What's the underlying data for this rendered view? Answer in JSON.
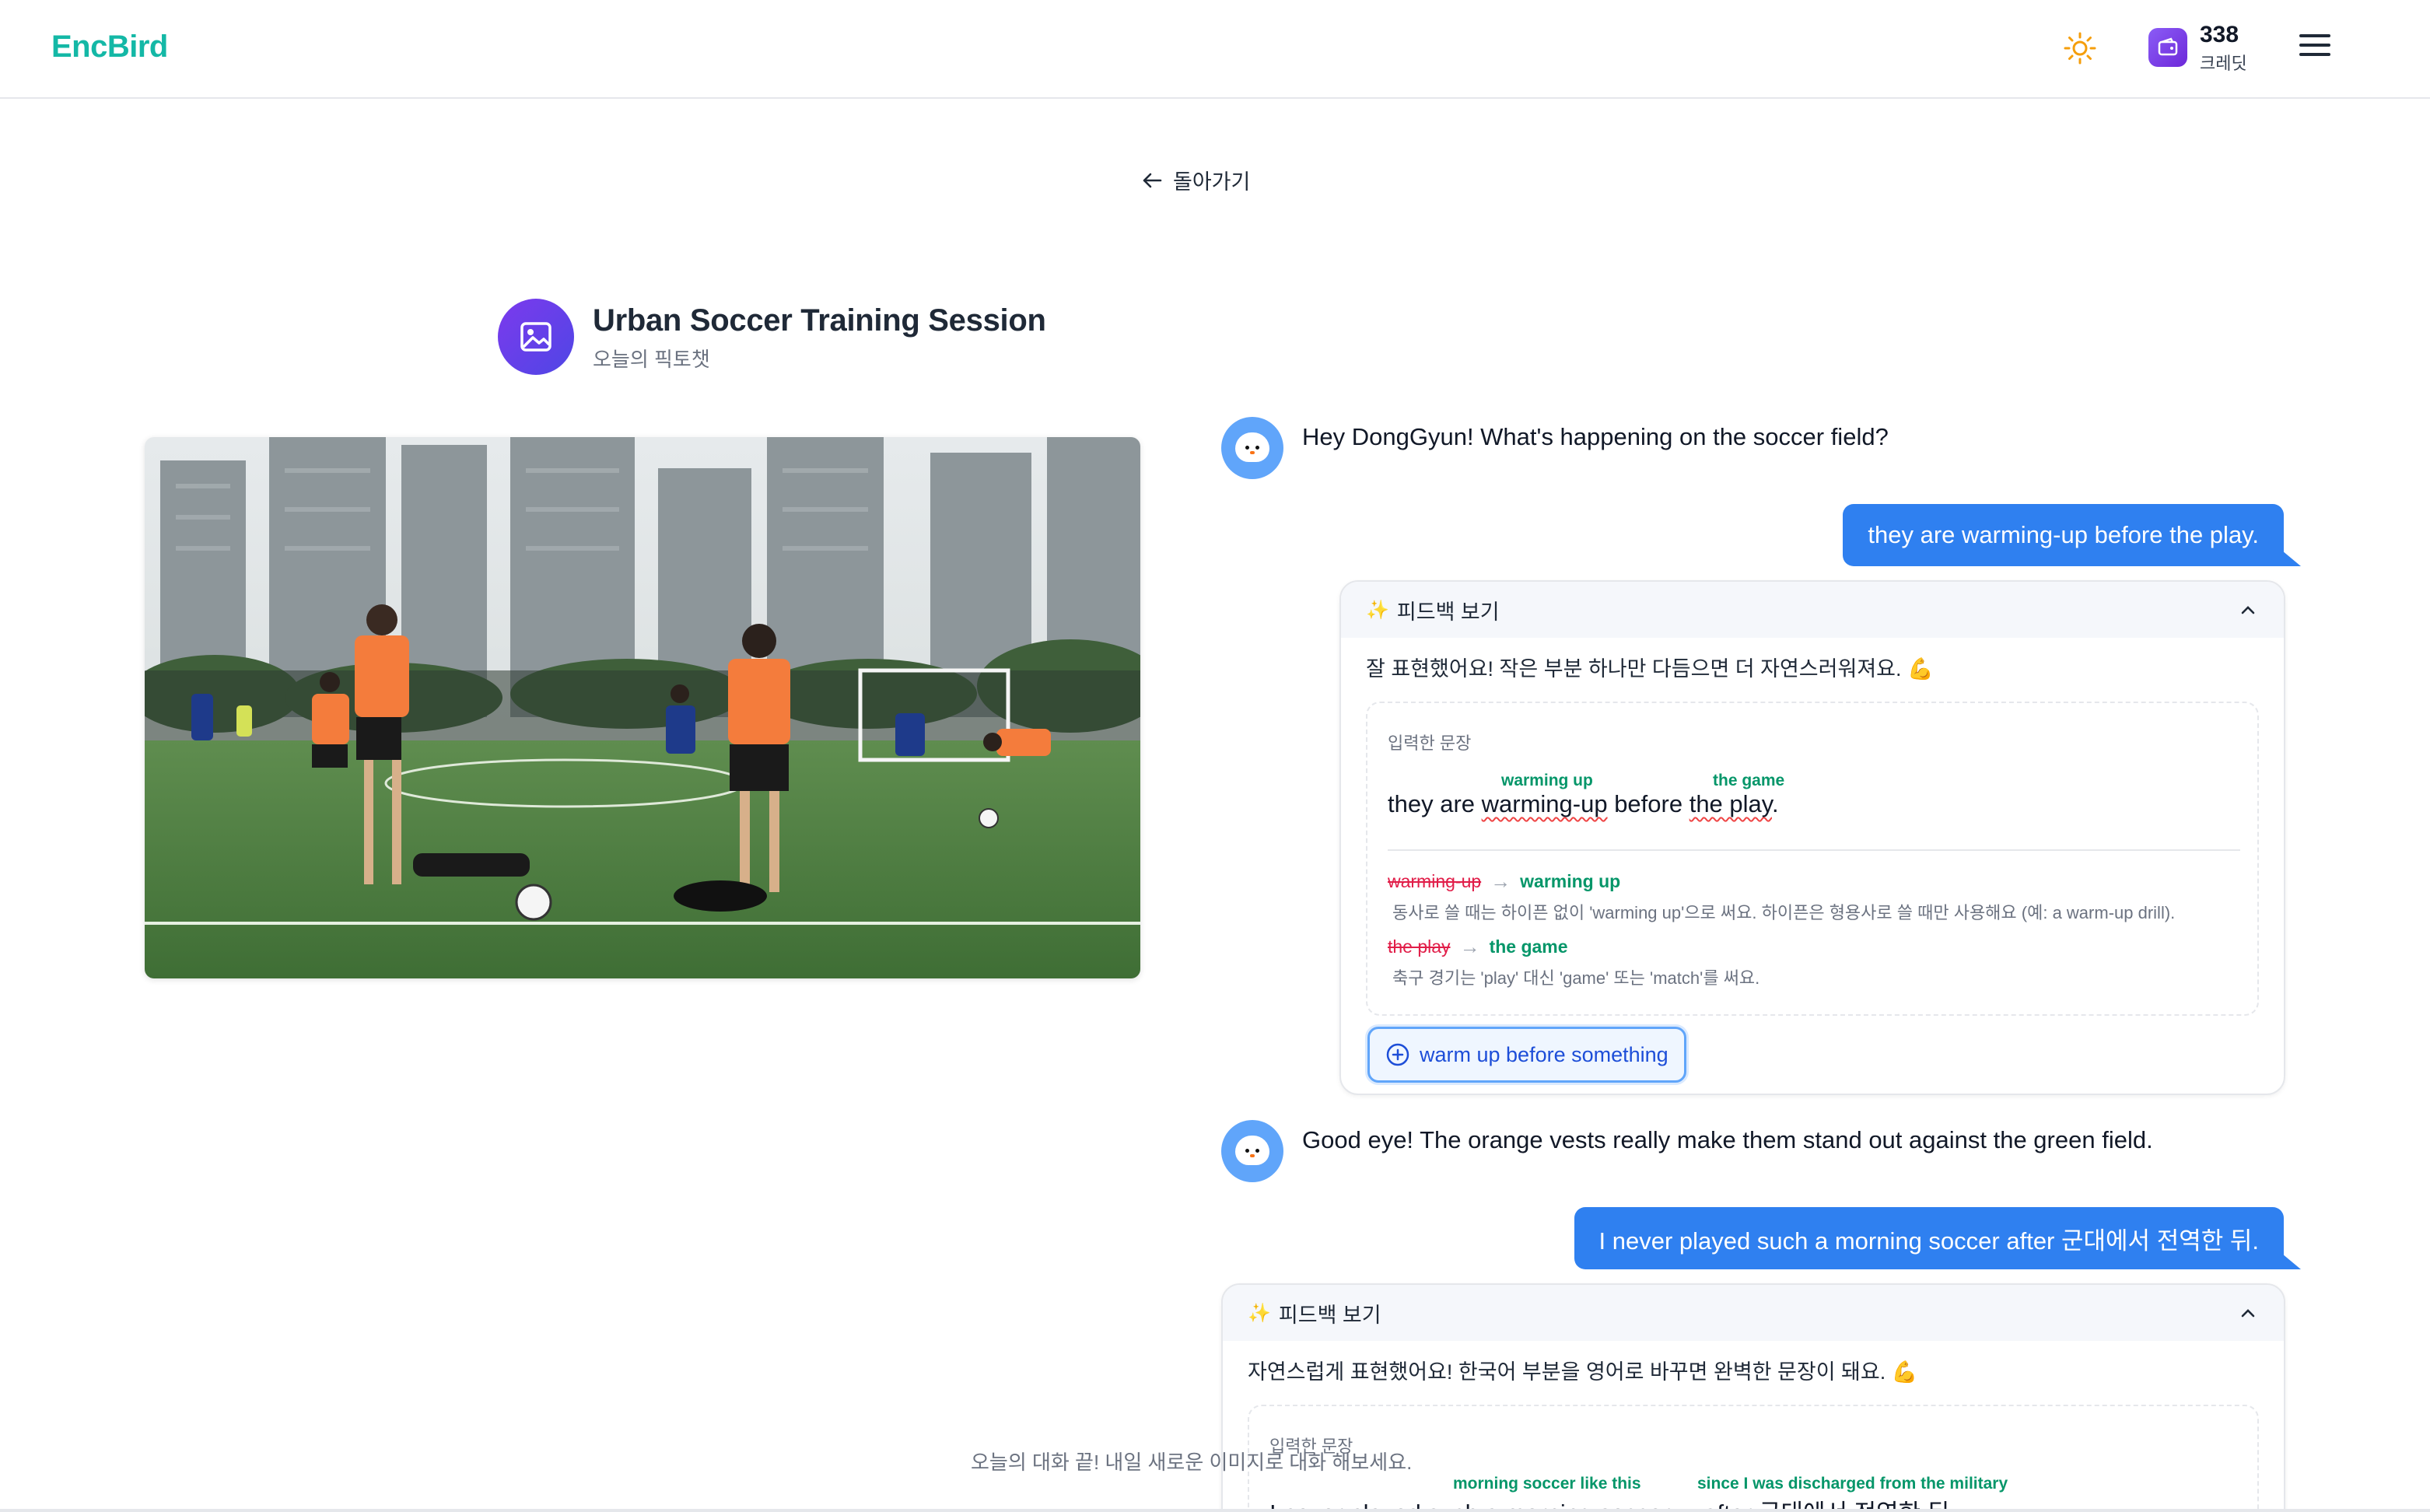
{
  "header": {
    "brand": "EncBird",
    "credits_value": "338",
    "credits_label": "크레딧",
    "accent_color": "#14b8a6"
  },
  "nav": {
    "back_label": "돌아가기"
  },
  "session": {
    "title": "Urban Soccer Training Session",
    "subtitle": "오늘의 픽토챗",
    "photo_alt": "Soccer players in orange vests warming up on an urban field surrounded by apartment buildings"
  },
  "chat": {
    "messages": [
      {
        "role": "bot",
        "text": "Hey DongGyun! What's happening on the soccer field?"
      },
      {
        "role": "user",
        "text": "they are warming-up before the play."
      },
      {
        "role": "bot",
        "text": "Good eye! The orange vests really make them stand out against the green field."
      },
      {
        "role": "user",
        "text": "I never played such a morning soccer after 군대에서 전역한 뒤."
      }
    ],
    "feedback1": {
      "toggle_label": "피드백 보기",
      "summary": "잘 표현했어요! 작은 부분 하나만 다듬으면 더 자연스러워져요. 💪",
      "input_label": "입력한 문장",
      "sentence_parts": [
        "they are ",
        "warming-up",
        " before ",
        "the play",
        "."
      ],
      "above_1": "warming up",
      "above_2": "the game",
      "corrections": [
        {
          "wrong": "warming-up",
          "right": "warming up",
          "explanation": "동사로 쓸 때는 하이픈 없이 'warming up'으로 써요. 하이픈은 형용사로 쓸 때만 사용해요 (예: a warm-up drill)."
        },
        {
          "wrong": "the play",
          "right": "the game",
          "explanation": "축구 경기는 'play' 대신 'game' 또는 'match'를 써요."
        }
      ],
      "phrase_chip": "warm up before something"
    },
    "feedback2": {
      "toggle_label": "피드백 보기",
      "summary": "자연스럽게 표현했어요! 한국어 부분을 영어로 바꾸면 완벽한 문장이 돼요. 💪",
      "input_label": "입력한 문장",
      "sentence_a": "I never played such a morning soccer",
      "sentence_b": "after 군대에서 전역한 뒤.",
      "above_1": "morning soccer like this",
      "above_2": "since I was discharged from the military"
    }
  },
  "footer": {
    "note": "오늘의 대화 끝! 내일 새로운 이미지로 대화 해보세요."
  }
}
